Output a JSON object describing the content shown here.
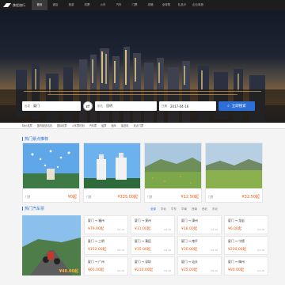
{
  "nav": {
    "logo": "携程旅行",
    "items": [
      "首页",
      "酒店",
      "旅游",
      "机票",
      "火车",
      "汽车",
      "门票",
      "攻略",
      "全球购",
      "礼品卡",
      "企业商旅"
    ],
    "active_index": 0
  },
  "search": {
    "from_label": "出发",
    "from_value": "厦门",
    "to_label": "到达",
    "to_value": "昆明",
    "date_label": "日期",
    "date_value": "2017-04-16",
    "button": "立即搜索"
  },
  "links": [
    "特价机票",
    "国内航班动态",
    "国际机票",
    "火车票时刻",
    "汽车票",
    "船票",
    "租车",
    "接送机",
    "景点门票"
  ],
  "section1": {
    "title": "热门景点推荐",
    "cards": [
      {
        "caption": "鼓浪屿",
        "label": "门票",
        "price": "¥0起"
      },
      {
        "caption": "厦门大学",
        "label": "门票",
        "price": "¥335.00起"
      },
      {
        "caption": "高原草甸",
        "label": "门票",
        "price": "¥12.50起"
      },
      {
        "caption": "高山草原",
        "label": "门票",
        "price": "¥32.50起"
      }
    ]
  },
  "section2": {
    "title": "热门汽车票",
    "tabs": [
      "全部",
      "华北",
      "华东",
      "华南",
      "西南",
      "西北",
      "东北"
    ],
    "tab_active": 0,
    "big_price": "¥40.00起",
    "routes": [
      {
        "route": "厦门 → 福州",
        "price": "¥79.00起",
        "date": "04-16"
      },
      {
        "route": "厦门 → 泉州",
        "price": "¥31.00起",
        "date": "04-16"
      },
      {
        "route": "厦门 → 漳州",
        "price": "¥18.00起",
        "date": "04-16"
      },
      {
        "route": "厦门 → 龙岩",
        "price": "¥6.00起",
        "date": "04-16"
      },
      {
        "route": "厦门 → 三明",
        "price": "¥152.00起",
        "date": "04-16"
      },
      {
        "route": "厦门 → 莆田",
        "price": "¥35.00起",
        "date": "04-16"
      },
      {
        "route": "厦门 → 南平",
        "price": "¥30.00起",
        "date": "04-16"
      },
      {
        "route": "厦门 → 宁德",
        "price": "¥230.00起",
        "date": "04-16"
      },
      {
        "route": "厦门 → 广州",
        "price": "¥65.00起",
        "date": "04-16"
      },
      {
        "route": "厦门 → 深圳",
        "price": "¥210.00起",
        "date": "04-16"
      },
      {
        "route": "厦门 → 汕头",
        "price": "¥35.00起",
        "date": "04-16"
      },
      {
        "route": "厦门 → 梅州",
        "price": "¥90.00起",
        "date": "04-16"
      }
    ]
  },
  "colors": {
    "accent": "#2d6fd6",
    "price": "#e85a1a",
    "nav_bg": "#1d1d1d"
  }
}
